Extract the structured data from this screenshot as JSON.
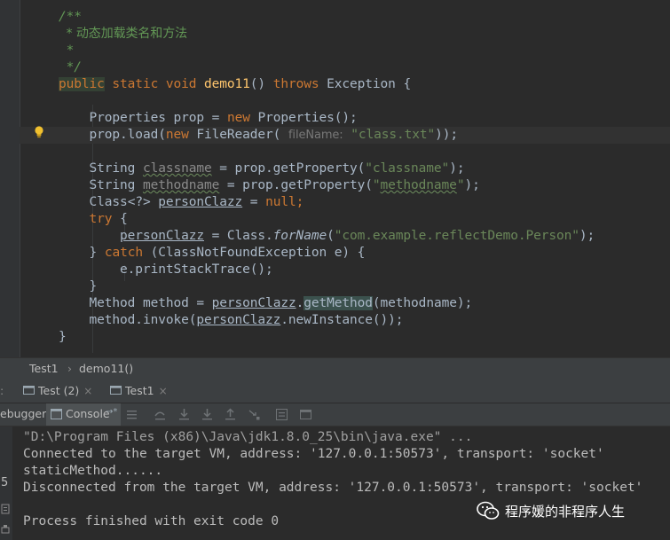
{
  "editor": {
    "comment": [
      "/**",
      "* 动态加载类名和方法",
      "*",
      "*/"
    ],
    "method_sig": {
      "kw_public": "public",
      "kw_static": "static",
      "kw_void": "void",
      "name": "demo11",
      "parens": "()",
      "kw_throws": "throws",
      "exception": "Exception",
      "brace": "{"
    },
    "line_props": {
      "type": "Properties",
      "var": "prop",
      "eq": "=",
      "kw_new": "new",
      "ctor": "Properties",
      "tail": "();"
    },
    "line_load": {
      "pre": "prop.load(",
      "kw_new": "new",
      "ctor": "FileReader(",
      "hint": "fileName:",
      "str": "\"class.txt\"",
      "tail": "));"
    },
    "line_classname": {
      "type": "String",
      "var": "classname",
      "mid": "= prop.getProperty(",
      "str_q1": "\"",
      "str_val": "classname",
      "str_q2": "\"",
      "tail": ");"
    },
    "line_methodname": {
      "type": "String",
      "var": "methodname",
      "mid": "= prop.getProperty(",
      "str_q1": "\"",
      "str_val": "methodname",
      "str_q2": "\"",
      "tail": ");"
    },
    "line_clazz": {
      "type": "Class",
      "generic": "<?>",
      "var": "personClazz",
      "eq": "=",
      "kw_null": "null",
      "tail": ";"
    },
    "line_try": {
      "kw": "try",
      "brace": "{"
    },
    "line_forname": {
      "var": "personClazz",
      "mid": "= Class.",
      "method": "forName",
      "open": "(",
      "str": "\"com.example.reflectDemo.Person\"",
      "tail": ");"
    },
    "line_catch": {
      "brace_close": "}",
      "kw": "catch",
      "rest": "(ClassNotFoundException e)",
      "brace": "{"
    },
    "line_trace": {
      "text": "e.printStackTrace();"
    },
    "line_close_try": "}",
    "line_method": {
      "type": "Method",
      "var": "method",
      "eq": "=",
      "clazz": "personClazz",
      "dot": ".",
      "getm": "getMethod",
      "rest": "(methodname);"
    },
    "line_invoke": {
      "pre": "method.invoke(",
      "clazz": "personClazz",
      "rest": ".newInstance());"
    },
    "line_end": "}"
  },
  "breadcrumb": {
    "item1": "Test1",
    "sep": "›",
    "item2": "demo11()"
  },
  "run_tabs": [
    {
      "label": "Test (2)",
      "close": "×"
    },
    {
      "label": "Test1",
      "close": "×"
    }
  ],
  "toolbar": {
    "debugger_label": "ebugger",
    "console_label": "Console",
    "console_suffix": "→*"
  },
  "console": {
    "lines": [
      "\"D:\\Program Files (x86)\\Java\\jdk1.8.0_25\\bin\\java.exe\" ...",
      "Connected to the target VM, address: '127.0.0.1:50573', transport: 'socket'",
      "staticMethod......",
      "Disconnected from the target VM, address: '127.0.0.1:50573', transport: 'socket'",
      "",
      "Process finished with exit code 0"
    ],
    "gutter_digit": "5"
  },
  "watermark": {
    "text": "程序媛的非程序人生",
    "icon": "wechat-icon"
  },
  "colors": {
    "keyword": "#cc7832",
    "comment": "#629755",
    "string": "#6a8759",
    "method_decl": "#ffc66d",
    "text": "#a9b7c6",
    "background": "#2b2b2b",
    "panel": "#3c3f41"
  }
}
